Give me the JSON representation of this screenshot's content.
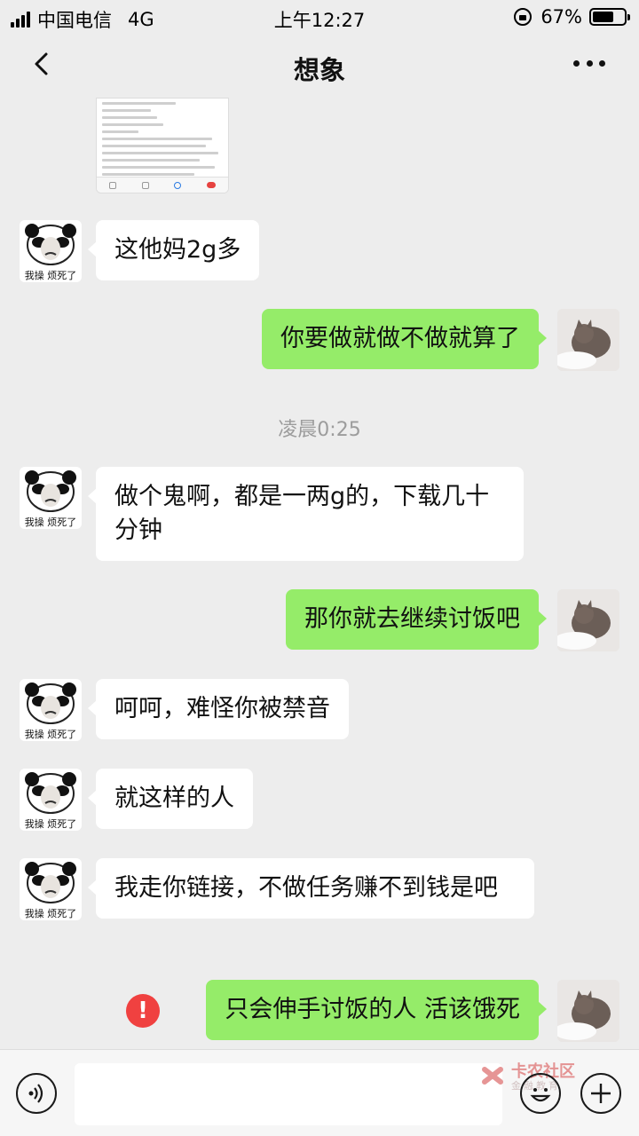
{
  "status_bar": {
    "carrier": "中国电信",
    "network": "4G",
    "time": "上午12:27",
    "battery_percent": "67%",
    "battery_level": 0.67
  },
  "header": {
    "title": "想象",
    "back_icon": "chevron-left-icon",
    "more_icon": "more-dots-icon"
  },
  "messages": [
    {
      "side": "left",
      "type": "image",
      "sender_caption": ""
    },
    {
      "side": "left",
      "type": "text",
      "text": "这他妈2g多",
      "sender_caption": "我操 烦死了"
    },
    {
      "side": "right",
      "type": "text",
      "text": "你要做就做不做就算了"
    },
    {
      "type": "time",
      "text": "凌晨0:25"
    },
    {
      "side": "left",
      "type": "text",
      "text": "做个鬼啊，都是一两g的，下载几十分钟",
      "sender_caption": "我操 烦死了"
    },
    {
      "side": "right",
      "type": "text",
      "text": "那你就去继续讨饭吧"
    },
    {
      "side": "left",
      "type": "text",
      "text": "呵呵，难怪你被禁音",
      "sender_caption": "我操 烦死了"
    },
    {
      "side": "left",
      "type": "text",
      "text": "就这样的人",
      "sender_caption": "我操 烦死了"
    },
    {
      "side": "left",
      "type": "text",
      "text": "我走你链接，不做任务赚不到钱是吧",
      "sender_caption": "我操 烦死了"
    },
    {
      "side": "right",
      "type": "text",
      "text": "只会伸手讨饭的人 活该饿死",
      "status": "failed",
      "status_icon": "!"
    }
  ],
  "input_bar": {
    "voice_icon": "voice-icon",
    "emoji_icon": "emoji-icon",
    "plus_icon": "plus-icon",
    "placeholder": ""
  },
  "watermark": {
    "title": "卡农社区",
    "subtitle": "金融教育"
  },
  "colors": {
    "background": "#ededed",
    "bubble_self": "#95ec69",
    "bubble_other": "#ffffff",
    "error": "#f04140"
  }
}
